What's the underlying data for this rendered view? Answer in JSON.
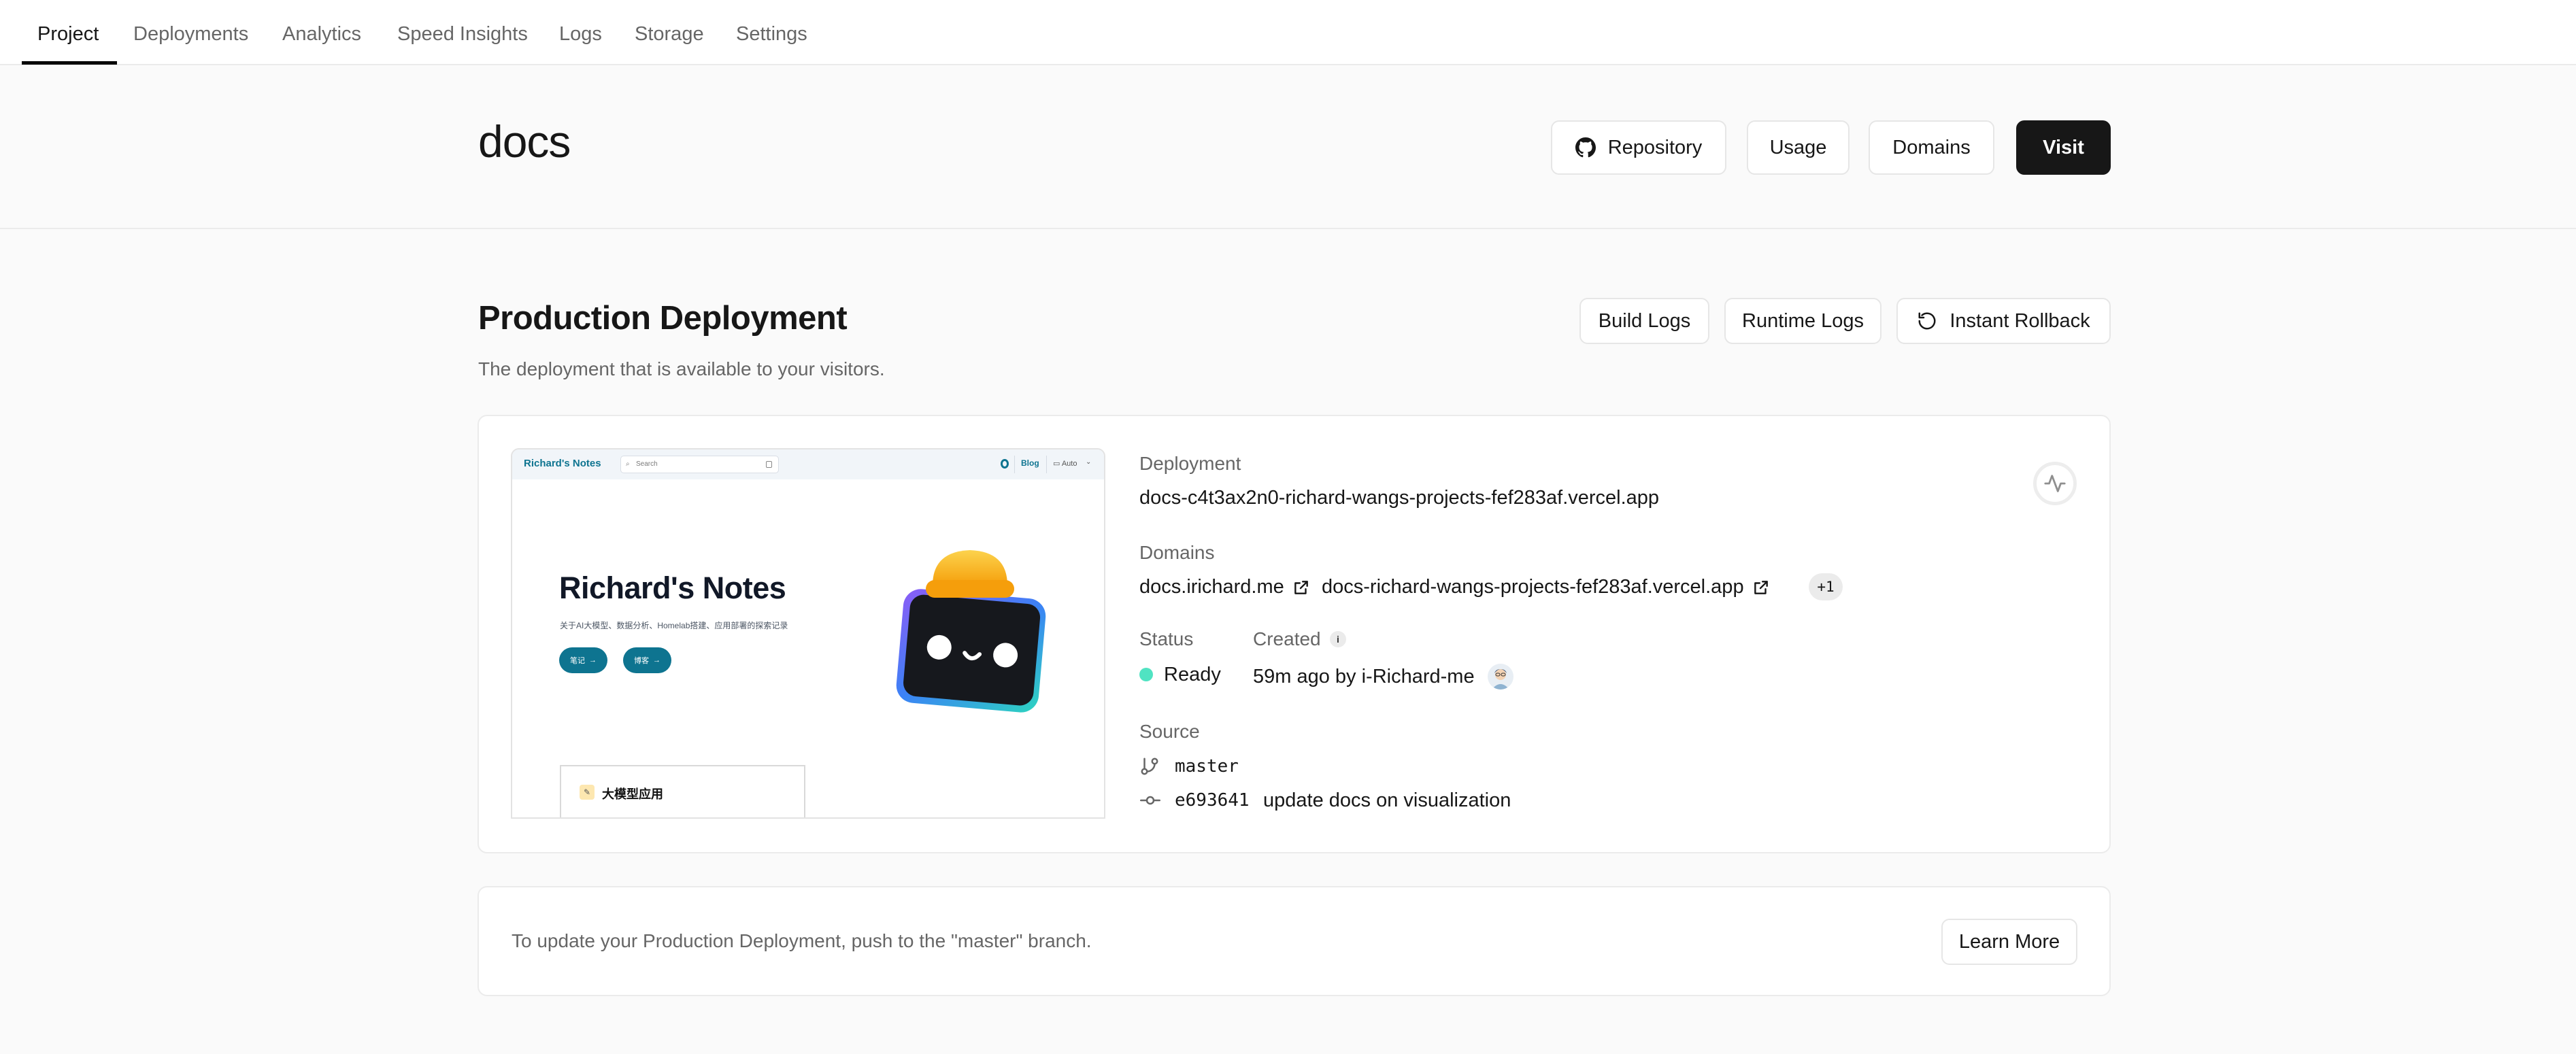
{
  "tabs": [
    {
      "label": "Project",
      "active": true
    },
    {
      "label": "Deployments",
      "active": false
    },
    {
      "label": "Analytics",
      "active": false
    },
    {
      "label": "Speed Insights",
      "active": false
    },
    {
      "label": "Logs",
      "active": false
    },
    {
      "label": "Storage",
      "active": false
    },
    {
      "label": "Settings",
      "active": false
    }
  ],
  "header": {
    "project_name": "docs",
    "buttons": {
      "repository": "Repository",
      "usage": "Usage",
      "domains": "Domains",
      "visit": "Visit"
    }
  },
  "production": {
    "title": "Production Deployment",
    "subtitle": "The deployment that is available to your visitors.",
    "buttons": {
      "build_logs": "Build Logs",
      "runtime_logs": "Runtime Logs",
      "instant_rollback": "Instant Rollback"
    }
  },
  "preview": {
    "brand": "Richard's Notes",
    "search_placeholder": "Search",
    "nav_blog": "Blog",
    "nav_theme": "Auto",
    "hero_title": "Richard's Notes",
    "hero_subtitle": "关于AI大模型、数据分析、Homelab搭建、应用部署的探索记录",
    "pill_notes": "笔记",
    "pill_blog": "博客",
    "card_title": "大模型应用"
  },
  "deployment": {
    "label": "Deployment",
    "url": "docs-c4t3ax2n0-richard-wangs-projects-fef283af.vercel.app",
    "domains_label": "Domains",
    "domains": [
      "docs.irichard.me",
      "docs-richard-wangs-projects-fef283af.vercel.app"
    ],
    "more_domains": "+1",
    "status_label": "Status",
    "status": "Ready",
    "status_color": "#50e3c2",
    "created_label": "Created",
    "created_info": "i",
    "created": "59m ago by i-Richard-me",
    "source_label": "Source",
    "branch": "master",
    "commit_hash": "e693641",
    "commit_message": "update docs on visualization"
  },
  "footer_card": {
    "message": "To update your Production Deployment, push to the \"master\" branch.",
    "learn_more": "Learn More"
  }
}
